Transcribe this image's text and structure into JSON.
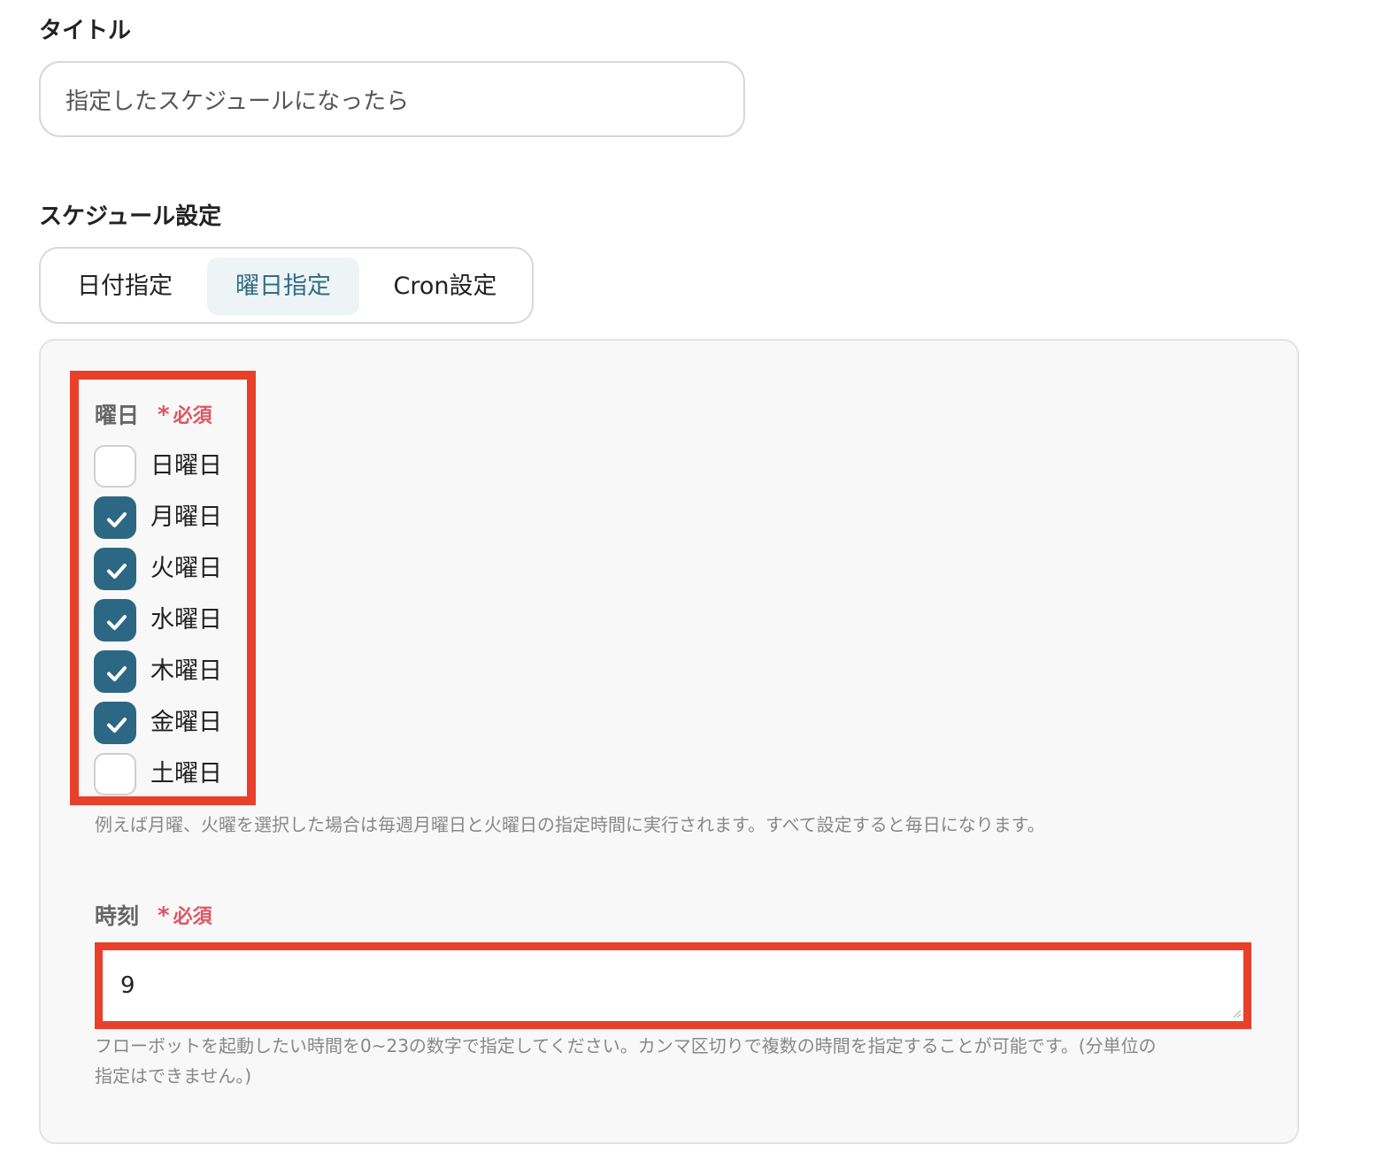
{
  "title_field": {
    "label": "タイトル",
    "value": "指定したスケジュールになったら"
  },
  "schedule": {
    "label": "スケジュール設定",
    "tabs": [
      {
        "label": "日付指定",
        "active": false
      },
      {
        "label": "曜日指定",
        "active": true
      },
      {
        "label": "Cron設定",
        "active": false
      }
    ]
  },
  "weekday": {
    "label": "曜日",
    "required_star": "*",
    "required_label": "必須",
    "days": [
      {
        "label": "日曜日",
        "checked": false
      },
      {
        "label": "月曜日",
        "checked": true
      },
      {
        "label": "火曜日",
        "checked": true
      },
      {
        "label": "水曜日",
        "checked": true
      },
      {
        "label": "木曜日",
        "checked": true
      },
      {
        "label": "金曜日",
        "checked": true
      },
      {
        "label": "土曜日",
        "checked": false
      }
    ],
    "help": "例えば月曜、火曜を選択した場合は毎週月曜日と火曜日の指定時間に実行されます。すべて設定すると毎日になります。"
  },
  "time": {
    "label": "時刻",
    "required_star": "*",
    "required_label": "必須",
    "value": "9",
    "help_line1": "フローボットを起動したい時間を0~23の数字で指定してください。カンマ区切りで複数の時間を指定することが可能です。(分単位の",
    "help_line2": "指定はできません。)"
  },
  "colors": {
    "accent": "#2c6884",
    "highlight": "#e8402a",
    "required": "#e05562",
    "active_tab_bg": "#eef4f6"
  }
}
